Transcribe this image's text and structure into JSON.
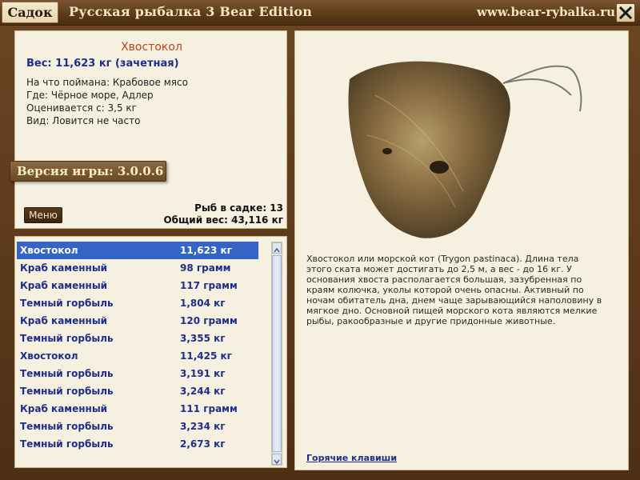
{
  "titlebar": {
    "tab_label": "Садок",
    "app_title": "Русская рыбалка 3 Bear Edition",
    "site": "www.bear-rybalka.ru"
  },
  "info": {
    "fish_name": "Хвостокол",
    "weight_line": "Вес: 11,623 кг (зачетная)",
    "details": [
      "На что поймана: Крабовое мясо",
      "Где: Чёрное море, Адлер",
      "Оценивается с: 3,5 кг",
      "Вид: Ловится не часто"
    ],
    "version": "Версия игры: 3.0.0.6",
    "menu_label": "Меню",
    "count_line": "Рыб в садке: 13",
    "total_line": "Общий вес: 43,116 кг"
  },
  "catch_list": [
    {
      "name": "Хвостокол",
      "weight": "11,623 кг"
    },
    {
      "name": "Краб каменный",
      "weight": "98 грамм"
    },
    {
      "name": "Краб каменный",
      "weight": "117 грамм"
    },
    {
      "name": "Темный горбыль",
      "weight": "1,804 кг"
    },
    {
      "name": "Краб каменный",
      "weight": "120 грамм"
    },
    {
      "name": "Темный горбыль",
      "weight": "3,355 кг"
    },
    {
      "name": "Хвостокол",
      "weight": "11,425 кг"
    },
    {
      "name": "Темный горбыль",
      "weight": "3,191 кг"
    },
    {
      "name": "Темный горбыль",
      "weight": "3,244 кг"
    },
    {
      "name": "Краб каменный",
      "weight": "111 грамм"
    },
    {
      "name": "Темный горбыль",
      "weight": "3,234 кг"
    },
    {
      "name": "Темный горбыль",
      "weight": "2,673 кг"
    }
  ],
  "selected_index": 0,
  "description": "Хвостокол или морской кот (Trygon pastinaca). Длина тела этого ската может достигать до 2,5 м, а вес - до 16 кг. У основания хвоста располагается большая, зазубренная по краям колючка, уколы которой очень опасны. Активный по ночам обитатель дна, днем чаще зарывающийся наполовину в мягкое дно. Основной пищей морского кота являются мелкие рыбы, ракообразные и другие придонные животные.",
  "hotkeys_label": "Горячие клавиши",
  "colors": {
    "accent_blue": "#1e2e8a",
    "selection": "#3465c6",
    "fish_name": "#c0421a",
    "frame": "#5a3a1c"
  }
}
